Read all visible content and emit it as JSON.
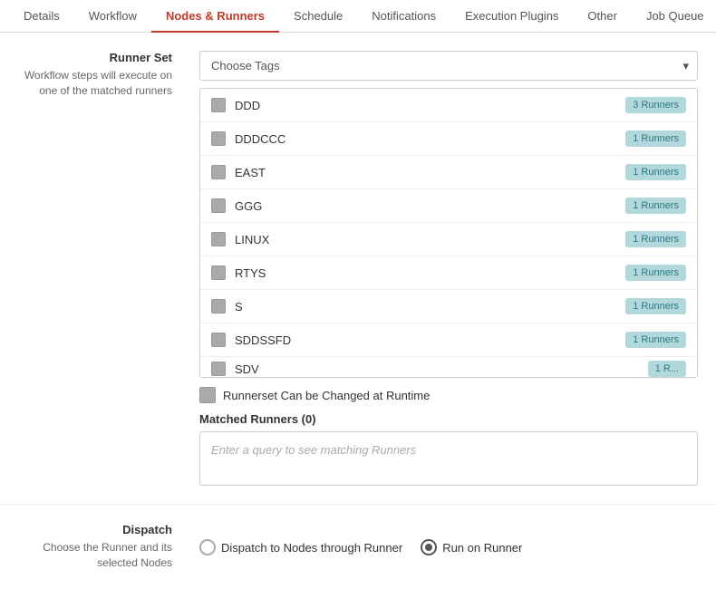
{
  "tabs": [
    {
      "id": "details",
      "label": "Details",
      "active": false
    },
    {
      "id": "workflow",
      "label": "Workflow",
      "active": false
    },
    {
      "id": "nodes-runners",
      "label": "Nodes & Runners",
      "active": true
    },
    {
      "id": "schedule",
      "label": "Schedule",
      "active": false
    },
    {
      "id": "notifications",
      "label": "Notifications",
      "active": false
    },
    {
      "id": "execution-plugins",
      "label": "Execution Plugins",
      "active": false
    },
    {
      "id": "other",
      "label": "Other",
      "active": false
    },
    {
      "id": "job-queue",
      "label": "Job Queue",
      "active": false
    }
  ],
  "runner_set": {
    "label": "Runner Set",
    "description": "Workflow steps will execute on one of the matched runners",
    "dropdown_placeholder": "Choose Tags",
    "runners": [
      {
        "name": "DDD",
        "count": "3 Runners"
      },
      {
        "name": "DDDCCC",
        "count": "1 Runners"
      },
      {
        "name": "EAST",
        "count": "1 Runners"
      },
      {
        "name": "GGG",
        "count": "1 Runners"
      },
      {
        "name": "LINUX",
        "count": "1 Runners"
      },
      {
        "name": "RTYS",
        "count": "1 Runners"
      },
      {
        "name": "S",
        "count": "1 Runners"
      },
      {
        "name": "SDDSSFD",
        "count": "1 Runners"
      },
      {
        "name": "SDV",
        "count": "1 R..."
      }
    ],
    "runnerset_check_label": "Runnerset Can be Changed at Runtime",
    "matched_runners_label": "Matched Runners (0)",
    "matched_runners_placeholder": "Enter a query to see matching Runners"
  },
  "dispatch": {
    "label": "Dispatch",
    "description": "Choose the Runner and its selected Nodes",
    "options": [
      {
        "id": "dispatch-nodes",
        "label": "Dispatch to Nodes through Runner",
        "selected": false
      },
      {
        "id": "run-on-runner",
        "label": "Run on Runner",
        "selected": true
      }
    ]
  }
}
